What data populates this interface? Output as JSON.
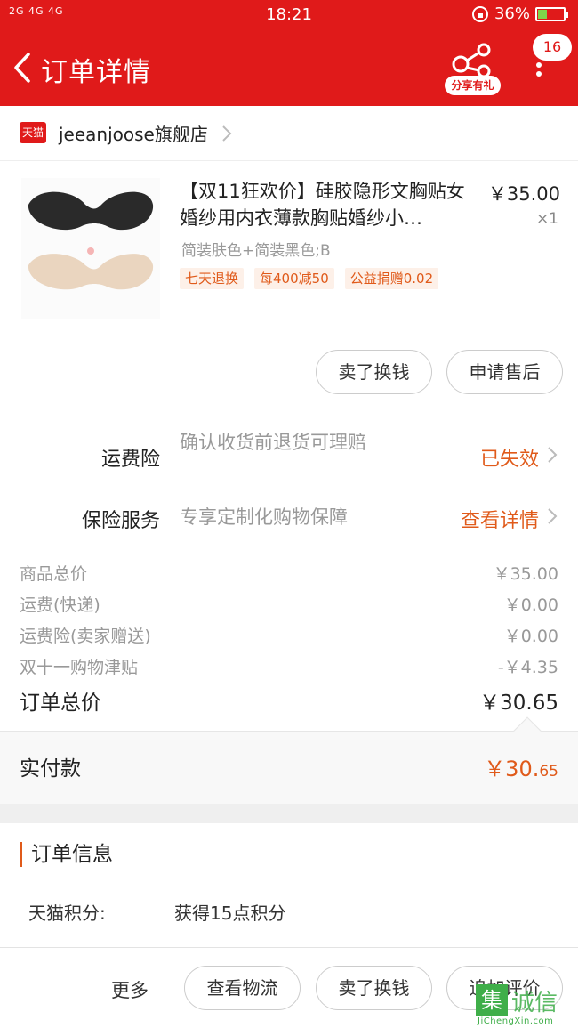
{
  "status_bar": {
    "network": "2G 4G 4G",
    "time": "18:21",
    "battery": "36%",
    "battery_level": 0.36
  },
  "header": {
    "title": "订单详情",
    "share_label": "分享有礼",
    "message_count": "16"
  },
  "shop": {
    "logo_text": "天猫",
    "name": "jeeanjoose旗舰店"
  },
  "product": {
    "title": "【双11狂欢价】硅胶隐形文胸贴女婚纱用内衣薄款胸贴婚纱小…",
    "price": "￥35.00",
    "quantity": "×1",
    "sku": "简装肤色+简装黑色;B",
    "tags": [
      "七天退换",
      "每400减50",
      "公益捐赠0.02"
    ],
    "buttons": [
      "卖了换钱",
      "申请售后"
    ]
  },
  "insurance": {
    "freight_label": "运费险",
    "freight_desc": "确认收货前退货可理赔",
    "freight_status": "已失效",
    "service_label": "保险服务",
    "service_desc": "专享定制化购物保障",
    "service_link": "查看详情"
  },
  "summary": {
    "rows": [
      {
        "label": "商品总价",
        "value": "￥35.00"
      },
      {
        "label": "运费(快递)",
        "value": "￥0.00"
      },
      {
        "label": "运费险(卖家赠送)",
        "value": "￥0.00"
      },
      {
        "label": "双十一购物津贴",
        "value": "-￥4.35"
      }
    ],
    "total_label": "订单总价",
    "total_value": "￥30.65",
    "paid_label": "实付款",
    "paid_value_main": "￥30.",
    "paid_value_cents": "65"
  },
  "order_info": {
    "title": "订单信息",
    "points_label": "天猫积分:",
    "points_value": "获得15点积分"
  },
  "bottom": {
    "more": "更多",
    "buttons": [
      "查看物流",
      "卖了换钱",
      "追加评价"
    ]
  },
  "watermark": {
    "char": "集",
    "text": "诚信",
    "url": "JiChengXin.com"
  },
  "colors": {
    "brand_red": "#e01a1a",
    "accent_orange": "#e05a1a"
  }
}
